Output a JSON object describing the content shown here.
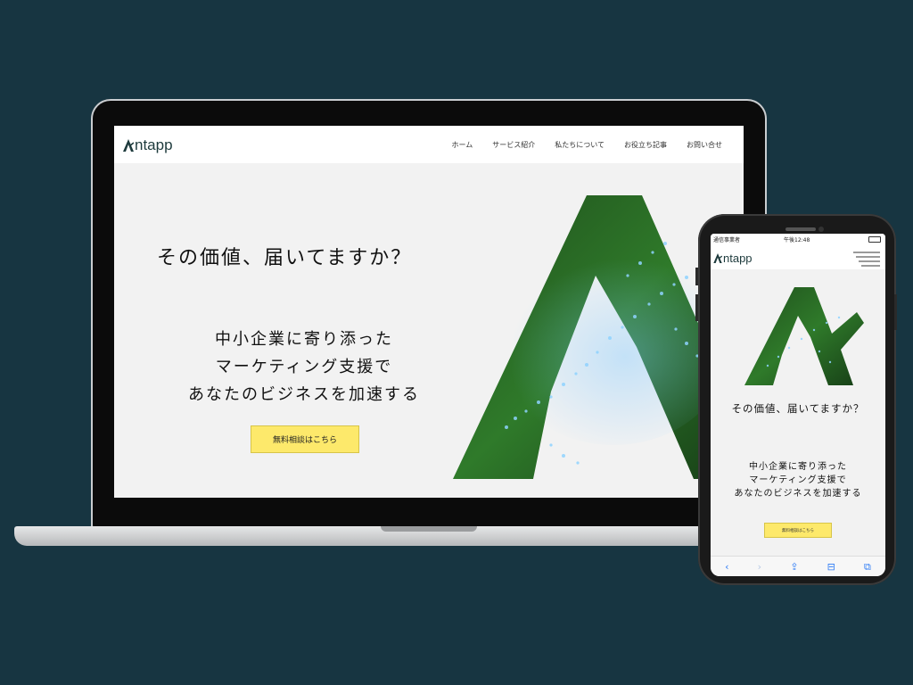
{
  "desktop": {
    "logo_text": "ntapp",
    "nav": [
      "ホーム",
      "サービス紹介",
      "私たちについて",
      "お役立ち記事",
      "お問い合せ"
    ],
    "hero_title": "その価値、届いてますか？",
    "hero_sub": [
      "中小企業に寄り添った",
      "マーケティング支援で",
      "あなたのビジネスを加速する"
    ],
    "cta_label": "無料相談はこちら"
  },
  "mobile": {
    "status": {
      "carrier": "通信事業者",
      "time": "午後12:48"
    },
    "logo_text": "ntapp",
    "hero_title": "その価値、届いてますか？",
    "hero_sub": [
      "中小企業に寄り添った",
      "マーケティング支援で",
      "あなたのビジネスを加速する"
    ],
    "cta_label": "無料相談はこちら",
    "toolbar": {
      "back": "‹",
      "forward": "›",
      "share": "⇪",
      "bookmarks": "⊟",
      "tabs": "⧉"
    }
  },
  "colors": {
    "background": "#173541",
    "accent": "#fde96b",
    "brand": "#1d3a3c",
    "art_green": "#2d6a25"
  }
}
